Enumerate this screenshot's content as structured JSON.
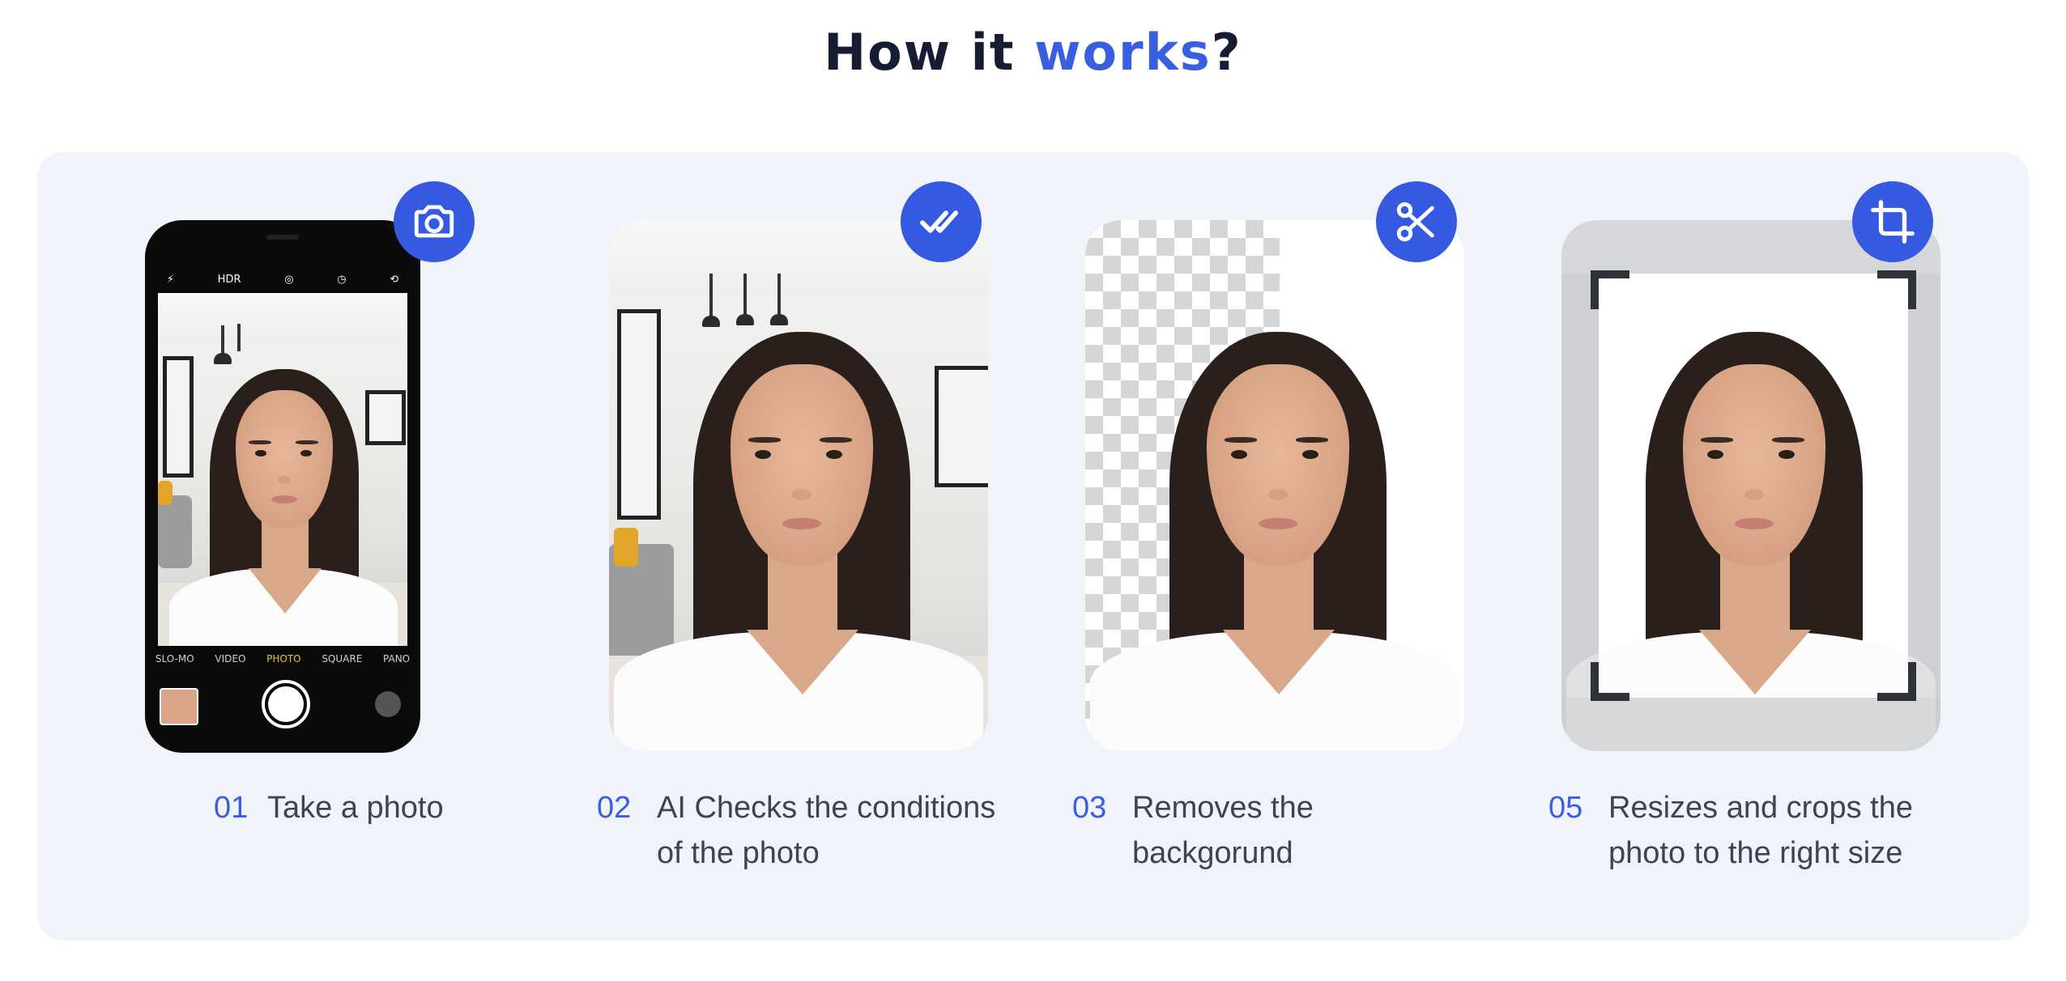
{
  "heading": {
    "prefix": "How it ",
    "accent": "works",
    "suffix": "?"
  },
  "colors": {
    "accent": "#3a5ee0",
    "badge": "#3559e0",
    "panel_bg": "#f0f3f9",
    "heading": "#161d33",
    "body_text": "#3b4455"
  },
  "phone_ui": {
    "topbar": [
      "HDR"
    ],
    "modes": [
      "SLO-MO",
      "VIDEO",
      "PHOTO",
      "SQUARE",
      "PANO"
    ],
    "active_mode": "PHOTO"
  },
  "steps": [
    {
      "number": "01",
      "line1": "Take a photo",
      "line2": "",
      "icon": "camera-icon"
    },
    {
      "number": "02",
      "line1": "AI Checks the conditions",
      "line2": "of the photo",
      "icon": "double-check-icon"
    },
    {
      "number": "03",
      "line1": "Removes the",
      "line2": "backgorund",
      "icon": "scissors-icon"
    },
    {
      "number": "05",
      "line1": "Resizes and crops the",
      "line2": "photo to the right size",
      "icon": "crop-icon"
    }
  ]
}
